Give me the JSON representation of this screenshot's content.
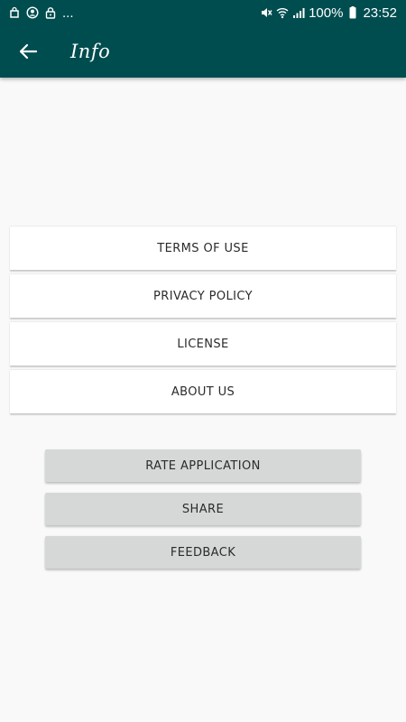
{
  "status_bar": {
    "left_icons": [
      "shopping-bag-icon",
      "account-circle-icon",
      "lock-icon"
    ],
    "overflow": "...",
    "right_icons": [
      "mute-icon",
      "wifi-icon",
      "signal-icon"
    ],
    "battery_percent": "100%",
    "time": "23:52"
  },
  "app_bar": {
    "title": "Info",
    "back_icon": "arrow-back-icon"
  },
  "list": {
    "items": [
      {
        "label": "TERMS OF USE"
      },
      {
        "label": "PRIVACY POLICY"
      },
      {
        "label": "LICENSE"
      },
      {
        "label": "ABOUT US"
      }
    ]
  },
  "actions": {
    "rate_label": "RATE APPLICATION",
    "share_label": "SHARE",
    "feedback_label": "FEEDBACK"
  },
  "colors": {
    "primary": "#004d4f",
    "background": "#f9f9f9",
    "button": "#d6d7d7",
    "text": "#2b2b2b"
  }
}
